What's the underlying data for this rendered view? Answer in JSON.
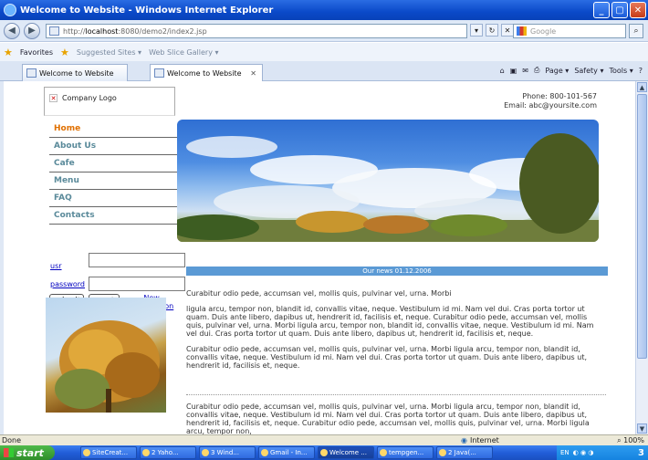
{
  "browser": {
    "title": "Welcome to Website - Windows Internet Explorer",
    "url_prefix": "http://",
    "url_host": "localhost",
    "url_rest": ":8080/demo2/index2.jsp",
    "search_placeholder": "Google",
    "favorites_label": "Favorites",
    "suggested_sites": "Suggested Sites ▾",
    "web_slice": "Web Slice Gallery ▾",
    "tabs": [
      "Welcome to Website",
      "Welcome to Website"
    ],
    "tab_tools": [
      "Page ▾",
      "Safety ▾",
      "Tools ▾"
    ],
    "status": "Done",
    "zone": "Internet",
    "zoom": "100%"
  },
  "page": {
    "logo_alt": "Company Logo",
    "phone": "Phone: 800-101-567",
    "email": "Email: abc@yoursite.com",
    "menu": [
      {
        "label": "Home",
        "active": true
      },
      {
        "label": "About Us",
        "active": false
      },
      {
        "label": "Cafe",
        "active": false
      },
      {
        "label": "Menu",
        "active": false
      },
      {
        "label": "FAQ",
        "active": false
      },
      {
        "label": "Contacts",
        "active": false
      }
    ],
    "login": {
      "user_label": "usr",
      "password_label": "password",
      "submit": "submit",
      "reset": "reset",
      "new_registration_1": "New",
      "new_registration_2": "Registration"
    },
    "news_header": "Our news 01.12.2006",
    "paragraphs": [
      "Curabitur odio pede, accumsan vel, mollis quis, pulvinar vel, urna. Morbi",
      "ligula arcu, tempor non, blandit id, convallis vitae, neque. Vestibulum id mi. Nam vel dui. Cras porta tortor ut quam. Duis ante libero, dapibus ut, hendrerit id, facilisis et, neque. Curabitur odio pede, accumsan vel, mollis quis, pulvinar vel, urna. Morbi ligula arcu, tempor non, blandit id, convallis vitae, neque. Vestibulum id mi. Nam vel dui. Cras porta tortor ut quam. Duis ante libero, dapibus ut, hendrerit id, facilisis et, neque.",
      "Curabitur odio pede, accumsan vel, mollis quis, pulvinar vel, urna. Morbi ligula arcu, tempor non, blandit id, convallis vitae, neque. Vestibulum id mi. Nam vel dui. Cras porta tortor ut quam. Duis ante libero, dapibus ut, hendrerit id, facilisis et, neque."
    ],
    "paragraph_bottom": "Curabitur odio pede, accumsan vel, mollis quis, pulvinar vel, urna. Morbi ligula arcu, tempor non, blandit id, convallis vitae, neque. Vestibulum id mi. Nam vel dui. Cras porta tortor ut quam. Duis ante libero, dapibus ut, hendrerit id, facilisis et, neque. Curabitur odio pede, accumsan vel, mollis quis, pulvinar vel, urna. Morbi ligula arcu, tempor non,"
  },
  "taskbar": {
    "start": "start",
    "items": [
      "SiteCreat...",
      "2 Yaho...",
      "3 Wind...",
      "Gmail - In...",
      "Welcome ...",
      "tempgen...",
      "2 Java(..."
    ],
    "lang": "EN",
    "clock": "3"
  }
}
